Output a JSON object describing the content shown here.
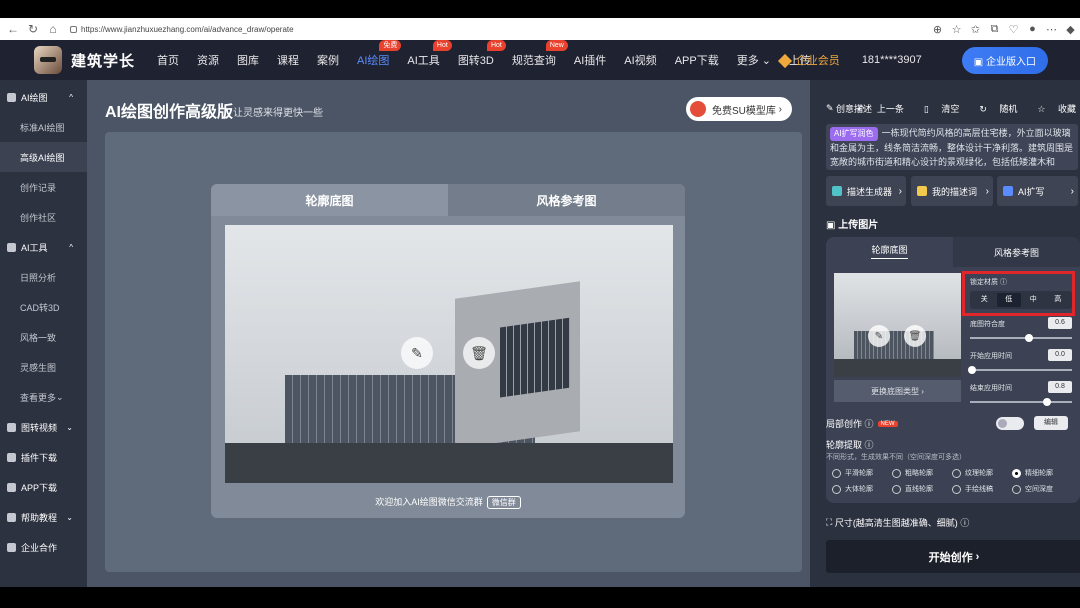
{
  "browser": {
    "url": "https://www.jianzhuxuezhang.com/ai/advance_draw/operate"
  },
  "header": {
    "logo_text": "建筑学长",
    "menu": [
      {
        "label": "首页",
        "badge": ""
      },
      {
        "label": "资源",
        "badge": ""
      },
      {
        "label": "图库",
        "badge": ""
      },
      {
        "label": "课程",
        "badge": ""
      },
      {
        "label": "案例",
        "badge": ""
      },
      {
        "label": "AI绘图",
        "badge": "免费"
      },
      {
        "label": "AI工具",
        "badge": "Hot"
      },
      {
        "label": "图转3D",
        "badge": "Hot"
      },
      {
        "label": "规范查询",
        "badge": "New"
      },
      {
        "label": "AI插件",
        "badge": ""
      },
      {
        "label": "AI视频",
        "badge": ""
      },
      {
        "label": "APP下载",
        "badge": ""
      },
      {
        "label": "更多",
        "badge": ""
      },
      {
        "label": "上传",
        "badge": ""
      }
    ],
    "vip": "企业会员",
    "phone": "181****3907",
    "enterprise_btn": "企业版入口"
  },
  "sidebar": {
    "g1": "AI绘图",
    "g1_items": [
      "标准AI绘图",
      "高级AI绘图",
      "创作记录",
      "创作社区"
    ],
    "g2": "AI工具",
    "g2_items": [
      "日照分析",
      "CAD转3D",
      "风格一致",
      "灵感生图",
      "查看更多"
    ],
    "g3": "图转视频",
    "g4": "插件下载",
    "g5": "APP下载",
    "g6": "帮助教程",
    "g7": "企业合作"
  },
  "main": {
    "title": "AI绘图创作高级版",
    "subtitle": "让灵感来得更快一些",
    "su_btn": "免费SU模型库",
    "tab1": "轮廓底图",
    "tab2": "风格参考图",
    "footer": "欢迎加入AI绘图微信交流群",
    "wechat": "微信群"
  },
  "right": {
    "desc_title": "创意描述",
    "prev": "上一条",
    "clear": "清空",
    "random": "随机",
    "fav": "收藏",
    "tag": "AI扩写润色",
    "desc_text": "一栋现代简约风格的高层住宅楼，外立面以玻璃和金属为主，线条简洁流畅，整体设计干净利落。建筑周围是宽敞的城市街道和精心设计的景观绿化，包括低矮灌木和",
    "btn1": "描述生成器",
    "btn2": "我的描述词",
    "btn3": "AI扩写",
    "upload_title": "上传图片",
    "utab1": "轮廓底图",
    "utab2": "风格参考图",
    "change_type": "更换底图类型",
    "lock_label": "锁定材质",
    "lock_opts": [
      "关",
      "低",
      "中",
      "高"
    ],
    "lock_selected": "低",
    "fit_label": "底图符合度",
    "fit_val": "0.6",
    "start_label": "开始应用时间",
    "start_val": "0.0",
    "end_label": "结束应用时间",
    "end_val": "0.8",
    "local_label": "局部创作",
    "new_badge": "NEW",
    "edit_btn": "编辑",
    "extract_label": "轮廓提取",
    "extract_hint": "不同形式，生成效果不同（空间深度可多选）",
    "extract_opts": [
      "平滑轮廓",
      "粗略轮廓",
      "纹理轮廓",
      "精细轮廓",
      "大体轮廓",
      "直线轮廓",
      "手绘线稿",
      "空间深度"
    ],
    "extract_selected": "精细轮廓",
    "size_label": "尺寸(越高清生图越准确、细腻)",
    "start_btn": "开始创作"
  }
}
